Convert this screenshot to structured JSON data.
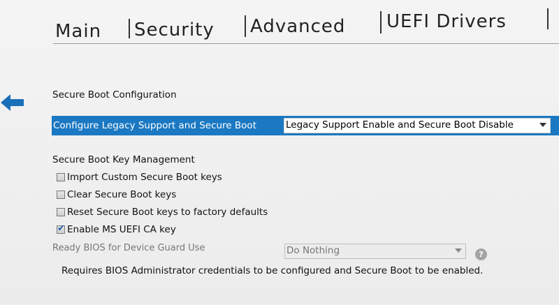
{
  "tabs": [
    {
      "label": "Main"
    },
    {
      "label": "Security"
    },
    {
      "label": "Advanced"
    },
    {
      "label": "UEFI Drivers"
    }
  ],
  "active_tab": "Advanced",
  "section_title": "Secure Boot Configuration",
  "legacy_setting": {
    "label": "Configure Legacy Support and Secure Boot",
    "value": "Legacy Support Enable and Secure Boot Disable"
  },
  "key_management": {
    "title": "Secure Boot Key Management",
    "options": [
      {
        "label": "Import Custom Secure Boot keys",
        "checked": false
      },
      {
        "label": "Clear Secure Boot keys",
        "checked": false
      },
      {
        "label": "Reset Secure Boot keys to factory defaults",
        "checked": false
      },
      {
        "label": "Enable MS UEFI CA key",
        "checked": true
      }
    ]
  },
  "device_guard": {
    "label": "Ready BIOS for Device Guard Use",
    "value": "Do Nothing",
    "help": "?"
  },
  "note": "Requires BIOS Administrator credentials to be configured and Secure Boot to be enabled.",
  "colors": {
    "highlight": "#1b78c2",
    "back_arrow": "#1a70b8"
  },
  "icons": {
    "back": "back-arrow-icon",
    "dropdown": "chevron-down-icon",
    "help": "help-icon",
    "check": "checkmark-icon"
  }
}
